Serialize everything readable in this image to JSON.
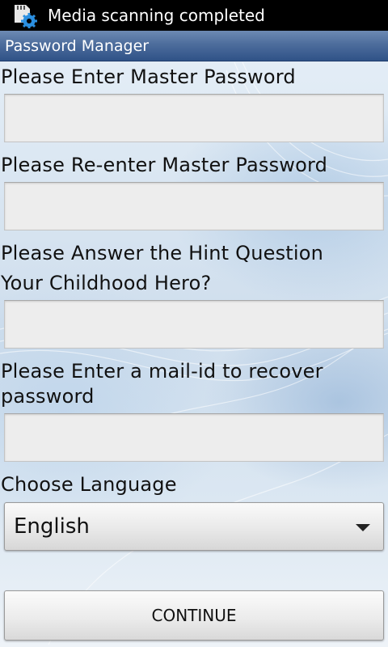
{
  "status_bar": {
    "notification_icon": "sd-card-gear-icon",
    "text": "Media scanning completed"
  },
  "app": {
    "title": "Password Manager"
  },
  "form": {
    "master_password_label": "Please Enter Master Password",
    "master_password_value": "",
    "reenter_password_label": "Please Re-enter Master Password",
    "reenter_password_value": "",
    "hint_question_label": "Please Answer the Hint Question",
    "hint_question_text": "Your Childhood Hero?",
    "hint_answer_value": "",
    "mail_id_label_line1": "Please Enter a mail-id to recover",
    "mail_id_label_line2": "password",
    "mail_id_value": "",
    "language_label": "Choose Language",
    "language_selected": "English",
    "continue_label": "CONTINUE"
  },
  "colors": {
    "title_bar": "#4d6d9c",
    "status_bar": "#000000",
    "field_bg": "#ededed"
  }
}
